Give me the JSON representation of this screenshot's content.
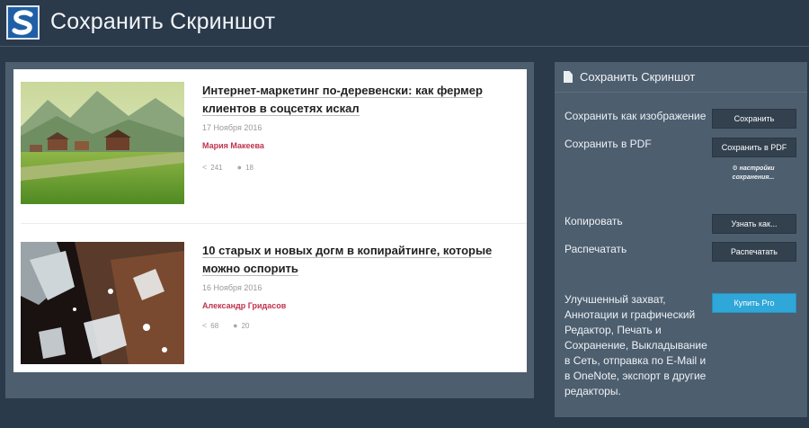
{
  "header": {
    "title": "Сохранить Скриншот"
  },
  "articles": [
    {
      "title": "Интернет-маркетинг по-деревенски: как фермер клиентов в соцсетях искал",
      "date": "17 Ноября 2016",
      "author": "Мария Макеева",
      "shares": "241",
      "comments": "18"
    },
    {
      "title": "10 старых и новых догм в копирайтинге, которые можно оспорить",
      "date": "16 Ноября 2016",
      "author": "Александр Гридасов",
      "shares": "68",
      "comments": "20"
    }
  ],
  "sidebar": {
    "title": "Сохранить Скриншот",
    "save_image_label": "Сохранить как изображение",
    "save_image_button": "Сохранить",
    "save_pdf_label": "Сохранить в PDF",
    "save_pdf_button": "Сохранить в PDF",
    "settings_link": "настройки сохранения...",
    "copy_label": "Копировать",
    "copy_button": "Узнать как...",
    "print_label": "Распечатать",
    "print_button": "Распечатать",
    "pro_description": "Улучшенный захват, Аннотации и графический Редактор, Печать и Сохранение, Выкладывание в Сеть, отправка по E-Mail и в OneNote, экспорт в другие редакторы.",
    "pro_button": "Купить Pro"
  },
  "icons": {
    "logo": "s-logo",
    "document": "document-icon",
    "gear": "gear-icon",
    "share": "share-icon",
    "comment": "comment-icon"
  },
  "colors": {
    "background": "#2b3a4b",
    "panel": "#4d5e6e",
    "button": "#33414f",
    "pro_button": "#2fa7d8",
    "author": "#c0324d"
  }
}
